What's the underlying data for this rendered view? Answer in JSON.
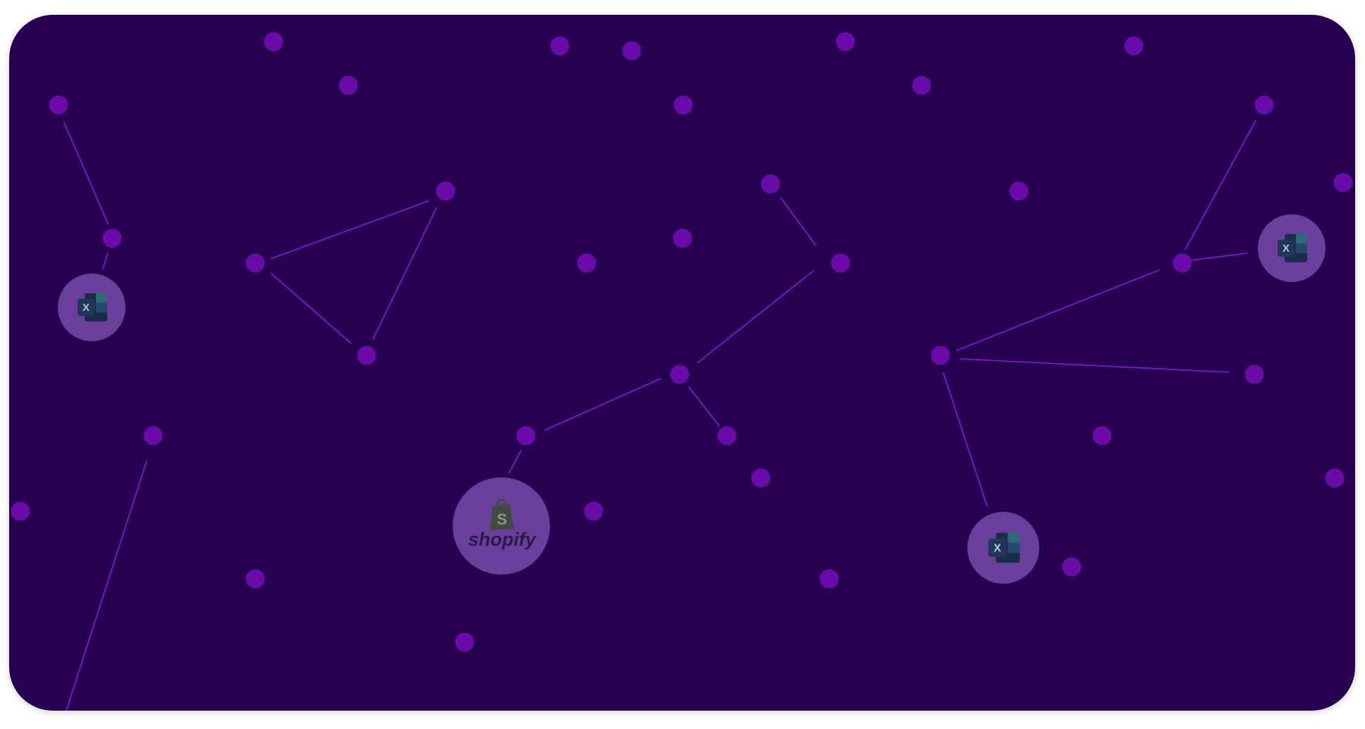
{
  "colors": {
    "background": "#270052",
    "node": "#6a0aa8",
    "edge": "#8a19d6",
    "badge": "#6a3f9b",
    "excel_dark": "#1b2b4a",
    "excel_mid": "#264a6e",
    "excel_light": "#2f6a79",
    "shopify_bag": "#3f4a40",
    "shopify_text": "#2a1a4a"
  },
  "icons": {
    "excel": "excel-icon",
    "shopify": "shopify-icon"
  },
  "labels": {
    "excel_letter": "X",
    "shopify_letter": "S",
    "shopify_wordmark": "shopify"
  }
}
